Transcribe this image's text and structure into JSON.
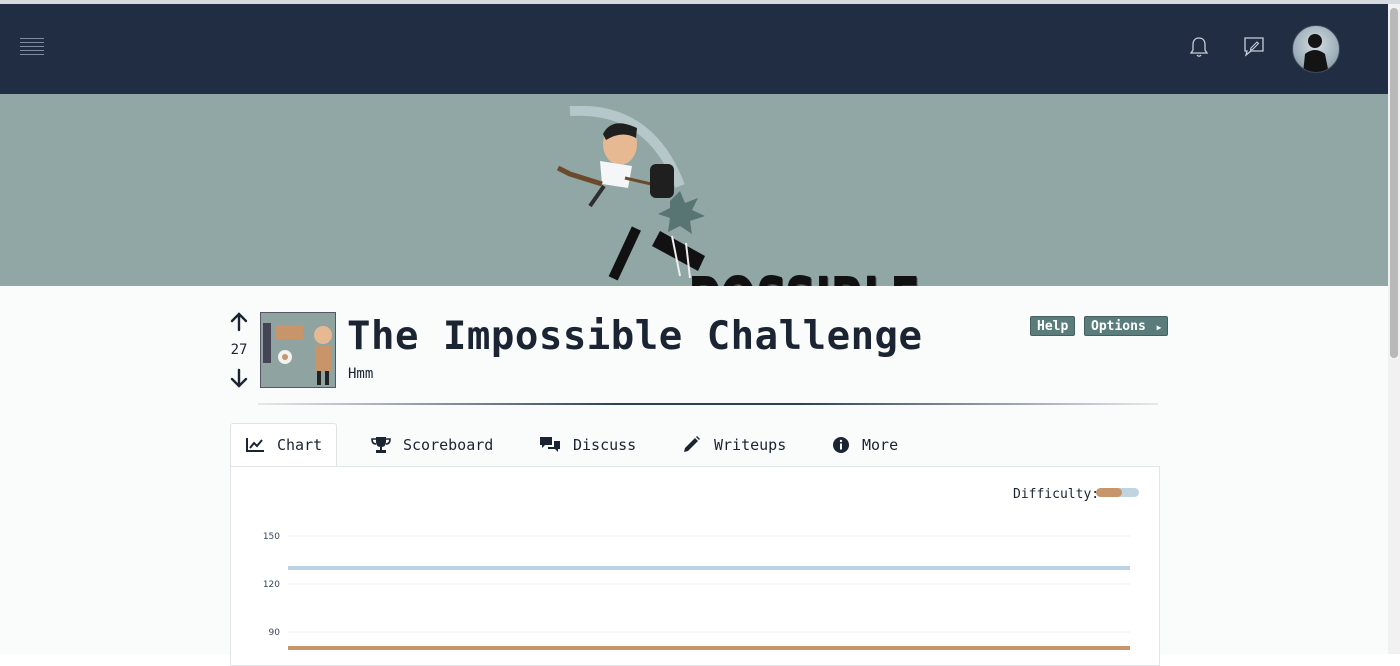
{
  "navbar": {
    "menu_icon": "hamburger-icon",
    "notification_icon": "bell-icon",
    "feedback_icon": "chat-edit-icon",
    "avatar_icon": "user-avatar"
  },
  "banner": {
    "logo_text": "POSSIBLE"
  },
  "challenge": {
    "votes": "27",
    "title": "The Impossible Challenge",
    "subtitle": "Hmm",
    "help_label": "Help",
    "options_label": "Options"
  },
  "tabs": [
    {
      "label": "Chart",
      "icon": "line-chart-icon",
      "active": true
    },
    {
      "label": "Scoreboard",
      "icon": "trophy-icon",
      "active": false
    },
    {
      "label": "Discuss",
      "icon": "comments-icon",
      "active": false
    },
    {
      "label": "Writeups",
      "icon": "pencil-icon",
      "active": false
    },
    {
      "label": "More",
      "icon": "info-icon",
      "active": false
    }
  ],
  "chart_panel": {
    "difficulty_label": "Difficulty:",
    "difficulty_fraction": 0.6
  },
  "colors": {
    "navbar": "#202d43",
    "banner": "#91a7a6",
    "button": "#5a7d7c",
    "series_blue": "#bcd4e6",
    "series_orange": "#c8946a"
  },
  "chart_data": {
    "type": "line",
    "title": "",
    "xlabel": "",
    "ylabel": "",
    "y_ticks": [
      150,
      120,
      90
    ],
    "series": [
      {
        "color": "#bcd4e6",
        "values": [
          130,
          130
        ]
      },
      {
        "color": "#c8946a",
        "values": [
          80,
          80
        ]
      }
    ],
    "grid": true
  }
}
